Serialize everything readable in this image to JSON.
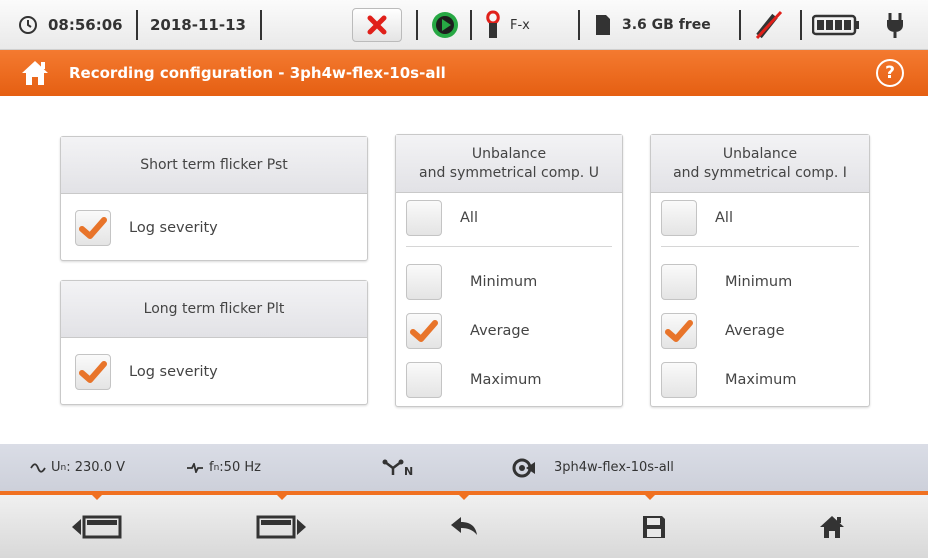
{
  "status_bar": {
    "time": "08:56:06",
    "date": "2018-11-13",
    "clamp_type": "F-x",
    "memory_free": "3.6 GB free",
    "icons": [
      "clock-icon",
      "stop-recording-icon",
      "record-start-icon",
      "clamp-icon",
      "memory-card-icon",
      "no-signal-icon",
      "battery-icon",
      "power-plug-icon"
    ]
  },
  "title_bar": {
    "title": "Recording configuration - 3ph4w-flex-10s-all",
    "help_label": "?"
  },
  "panels": {
    "pst": {
      "title": "Short term flicker Pst",
      "option": {
        "label": "Log severity",
        "checked": true
      }
    },
    "plt": {
      "title": "Long term flicker Plt",
      "option": {
        "label": "Log severity",
        "checked": true
      }
    },
    "unbalance_u": {
      "title_line1": "Unbalance",
      "title_line2": "and symmetrical comp. U",
      "all": {
        "label": "All",
        "checked": false
      },
      "options": [
        {
          "label": "Minimum",
          "checked": false
        },
        {
          "label": "Average",
          "checked": true
        },
        {
          "label": "Maximum",
          "checked": false
        }
      ]
    },
    "unbalance_i": {
      "title_line1": "Unbalance",
      "title_line2": "and symmetrical comp. I",
      "all": {
        "label": "All",
        "checked": false
      },
      "options": [
        {
          "label": "Minimum",
          "checked": false
        },
        {
          "label": "Average",
          "checked": true
        },
        {
          "label": "Maximum",
          "checked": false
        }
      ]
    }
  },
  "info_bar": {
    "un_symbol": "U",
    "un_sub": "n",
    "un_value": ": 230.0 V",
    "fn_symbol": "f",
    "fn_sub": "n",
    "fn_value": ":50 Hz",
    "network_sub": "N",
    "config_name": "3ph4w-flex-10s-all"
  },
  "toolbar": {
    "buttons": [
      "previous-screen-icon",
      "next-screen-icon",
      "back-icon",
      "save-icon",
      "home-icon"
    ]
  },
  "colors": {
    "accent": "#f07020",
    "check": "#e8742a",
    "stop_red": "#e0201a",
    "start_green": "#27a844"
  }
}
